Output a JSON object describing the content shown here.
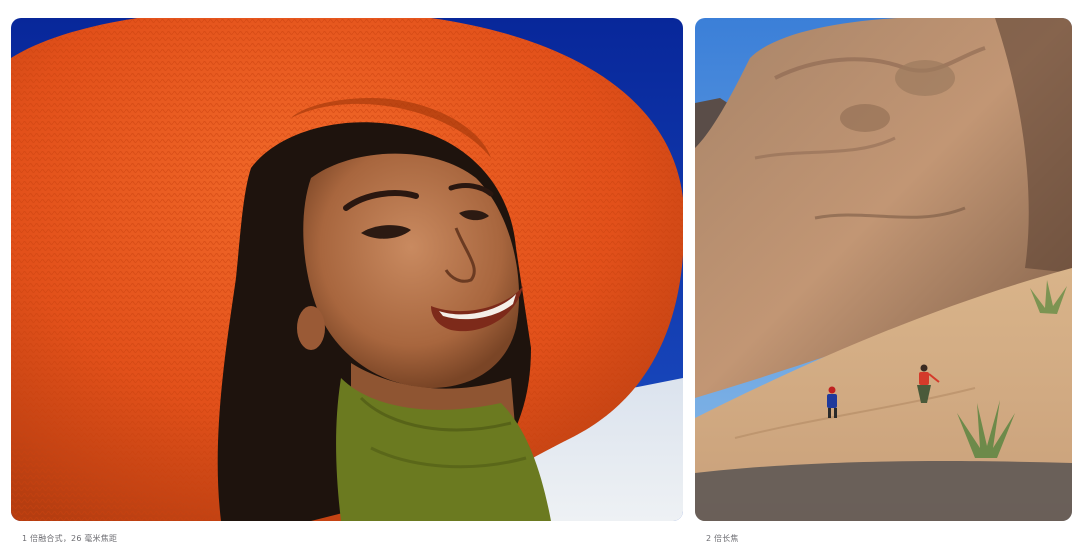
{
  "gallery": {
    "photos": [
      {
        "caption": "1 倍融合式，26 毫米焦距",
        "subject": "woman-in-orange-sun-hat"
      },
      {
        "caption": "2 倍长焦",
        "subject": "hikers-below-rock-cliff"
      }
    ]
  },
  "colors": {
    "sky_deep": "#0a2a8c",
    "hat_orange": "#e8521a",
    "sweater_green": "#6b7a20",
    "rock_tan": "#c9a07a",
    "caption_gray": "#6e6e73"
  }
}
